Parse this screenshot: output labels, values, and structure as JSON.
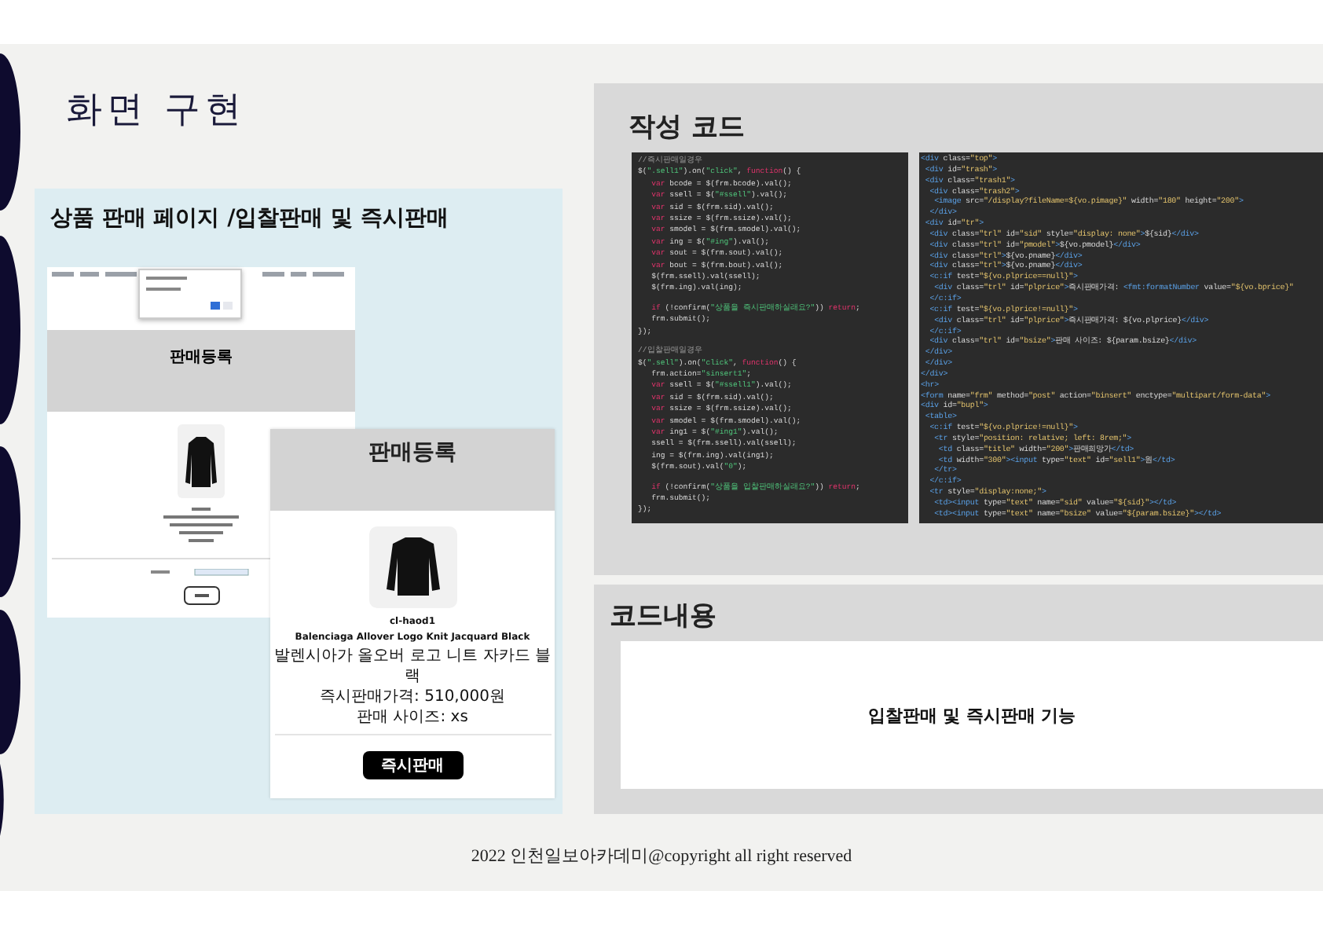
{
  "slide": {
    "title": "화면 구현"
  },
  "left_panel": {
    "heading": "상품 판매 페이지 /입찰판매  및 즉시판매",
    "screenshot_back": {
      "title": "판매등록"
    },
    "screenshot_front": {
      "title": "판매등록",
      "product_code": "cl-haod1",
      "product_name_en": "Balenciaga Allover Logo Knit Jacquard Black",
      "product_name_ko": "발렌시아가 올오버 로고 니트 자카드 블랙",
      "price": "즉시판매가격: 510,000원",
      "size": "판매 사이즈: xs",
      "button": "즉시판매"
    }
  },
  "code_panel": {
    "heading": "작성 코드",
    "script_blocks": [
      [
        "//즉시판매일경우",
        "$(\".sell1\").on(\"click\", function() {",
        "   var bcode = $(frm.bcode).val();",
        "   var ssell = $(\"#ssell\").val();",
        "   var sid = $(frm.sid).val();",
        "   var ssize = $(frm.ssize).val();",
        "   var smodel = $(frm.smodel).val();",
        "   var ing = $(\"#ing\").val();",
        "   var sout = $(frm.sout).val();",
        "   var bout = $(frm.bout).val();",
        "   $(frm.ssell).val(ssell);",
        "   $(frm.ing).val(ing);"
      ],
      [
        "   if (!confirm(\"상품을 즉시판매하실래요?\")) return;",
        "   frm.submit();",
        "});"
      ],
      [
        "//입찰판매일경우",
        "$(\".sell\").on(\"click\", function() {",
        "   frm.action=\"sinsert1\";",
        "   var ssell = $(\"#ssell1\").val();",
        "   var sid = $(frm.sid).val();",
        "   var ssize = $(frm.ssize).val();",
        "   var smodel = $(frm.smodel).val();",
        "   var ing1 = $(\"#ing1\").val();",
        "   ssell = $(frm.ssell).val(ssell);",
        "   ing = $(frm.ing).val(ing1);",
        "   $(frm.sout).val(\"0\");"
      ],
      [
        "   if (!confirm(\"상품을 입찰판매하실래요?\")) return;",
        "   frm.submit();",
        "});"
      ]
    ],
    "markup_lines": [
      "<div class=\"top\">",
      " <div id=\"trash\">",
      " <div class=\"trash1\">",
      "  <div class=\"trash2\">",
      "   <image src=\"/display?fileName=${vo.pimage}\" width=\"180\" height=\"200\">",
      "  </div>",
      " <div id=\"tr\">",
      "  <div class=\"trl\" id=\"sid\" style=\"display: none\">${sid}</div>",
      "  <div class=\"trl\" id=\"pmodel\">${vo.pmodel}</div>",
      "  <div class=\"trl\">${vo.pname}</div>",
      "  <div class=\"trl\">${vo.pname}</div>",
      "  <c:if test=\"${vo.plprice==null}\">",
      "   <div class=\"trl\" id=\"plprice\">즉시판매가격: <fmt:formatNumber value=\"${vo.bprice}\"",
      "  </c:if>",
      "  <c:if test=\"${vo.plprice!=null}\">",
      "   <div class=\"trl\" id=\"plprice\">즉시판매가격: ${vo.plprice}</div>",
      "  </c:if>",
      "  <div class=\"trl\" id=\"bsize\">판매 사이즈: ${param.bsize}</div>",
      " </div>",
      " </div>",
      "</div>",
      "<hr>",
      "<form name=\"frm\" method=\"post\" action=\"binsert\" enctype=\"multipart/form-data\">",
      "<div id=\"bupl\">",
      " <table>",
      "  <c:if test=\"${vo.plprice!=null}\">",
      "   <tr style=\"position: relative; left: 8rem;\">",
      "    <td class=\"title\" width=\"200\">판매희망가</td>",
      "    <td width=\"300\"><input type=\"text\" id=\"sell1\">원</td>",
      "   </tr>",
      "  </c:if>",
      "  <tr style=\"display:none;\">",
      "   <td><input type=\"text\" name=\"sid\" value=\"${sid}\"></td>",
      "   <td><input type=\"text\" name=\"bsize\" value=\"${param.bsize}\"></td>"
    ]
  },
  "description_panel": {
    "heading": "코드내용",
    "text": "입찰판매 및 즉시판매 기능"
  },
  "footer": "2022 인천일보아카데미@copyright all right reserved"
}
